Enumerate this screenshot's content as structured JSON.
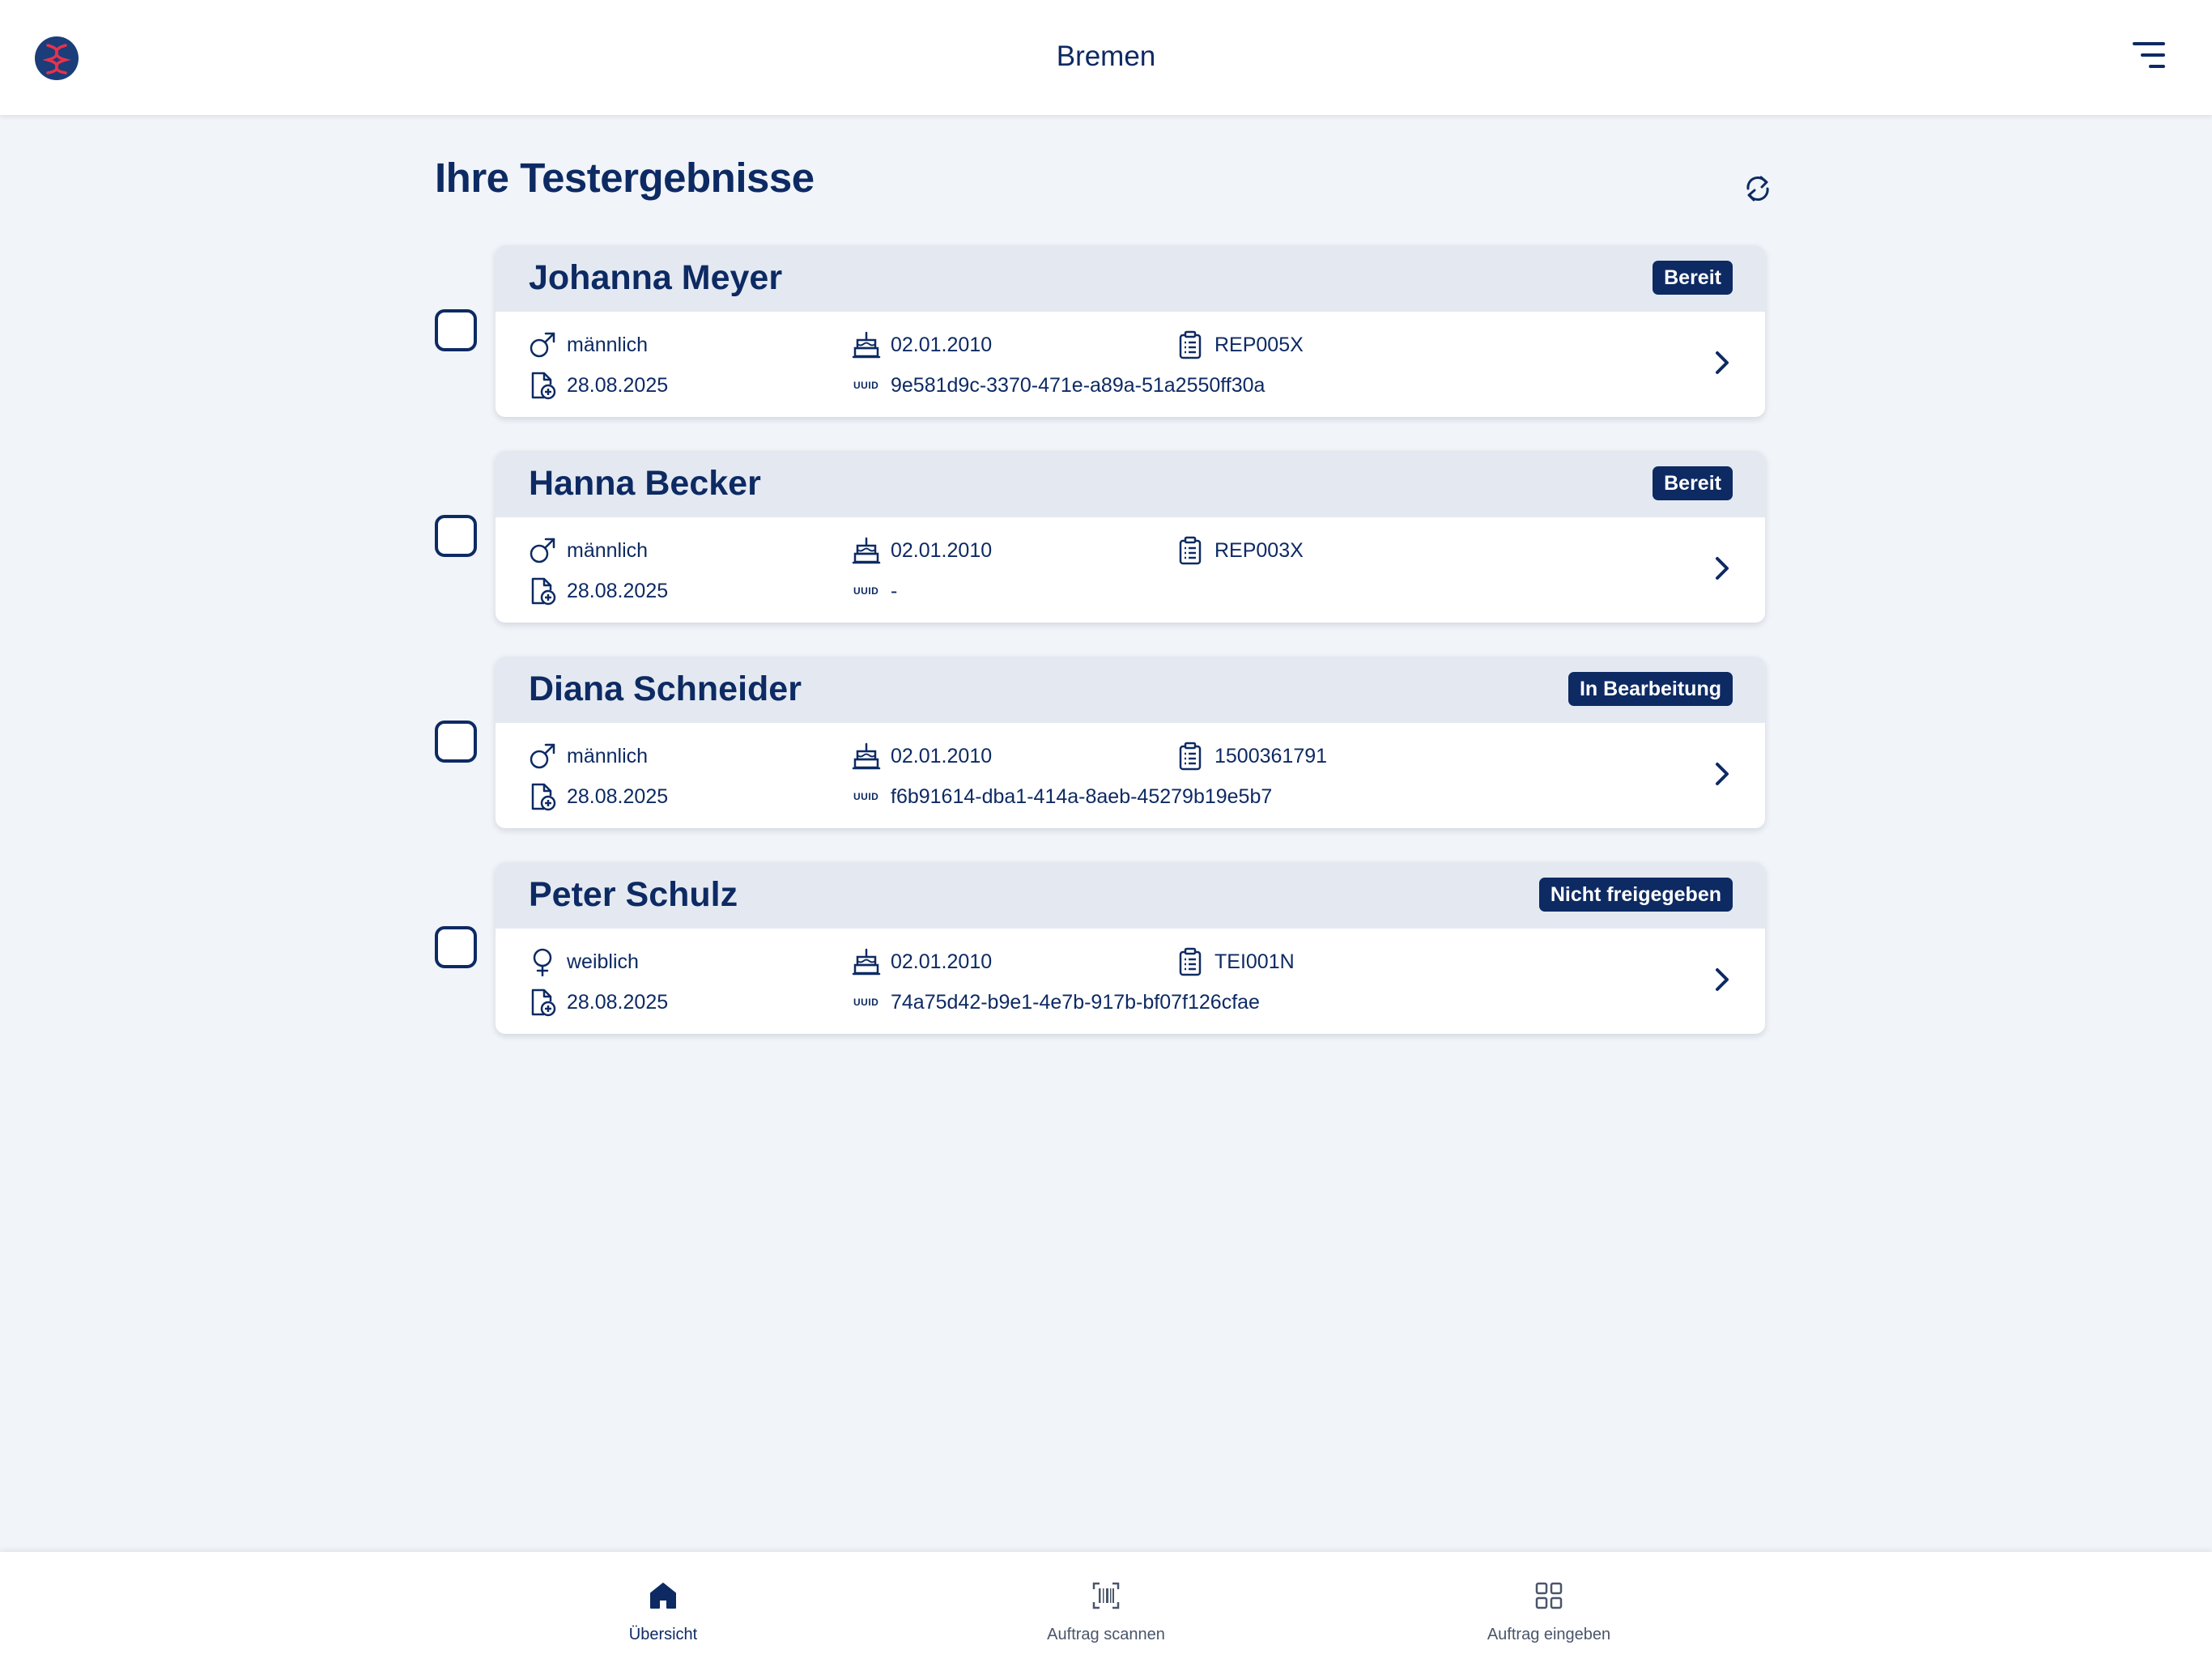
{
  "header": {
    "city": "Bremen"
  },
  "page": {
    "title": "Ihre Testergebnisse"
  },
  "results": [
    {
      "name": "Johanna Meyer",
      "status": "Bereit",
      "gender": "männlich",
      "gender_icon": "male-icon",
      "birthdate": "02.01.2010",
      "order_id": "REP005X",
      "created": "28.08.2025",
      "uuid_label": "UUID",
      "uuid": "9e581d9c-3370-471e-a89a-51a2550ff30a"
    },
    {
      "name": "Hanna Becker",
      "status": "Bereit",
      "gender": "männlich",
      "gender_icon": "male-icon",
      "birthdate": "02.01.2010",
      "order_id": "REP003X",
      "created": "28.08.2025",
      "uuid_label": "UUID",
      "uuid": "-"
    },
    {
      "name": "Diana Schneider",
      "status": "In Bearbeitung",
      "gender": "männlich",
      "gender_icon": "male-icon",
      "birthdate": "02.01.2010",
      "order_id": "1500361791",
      "created": "28.08.2025",
      "uuid_label": "UUID",
      "uuid": "f6b91614-dba1-414a-8aeb-45279b19e5b7"
    },
    {
      "name": "Peter Schulz",
      "status": "Nicht freigegeben",
      "gender": "weiblich",
      "gender_icon": "female-icon",
      "birthdate": "02.01.2010",
      "order_id": "TEI001N",
      "created": "28.08.2025",
      "uuid_label": "UUID",
      "uuid": "74a75d42-b9e1-4e7b-917b-bf07f126cfae"
    }
  ],
  "bottom_nav": [
    {
      "label": "Übersicht",
      "icon": "home-icon",
      "active": true
    },
    {
      "label": "Auftrag scannen",
      "icon": "scan-icon",
      "active": false
    },
    {
      "label": "Auftrag eingeben",
      "icon": "grid-icon",
      "active": false
    }
  ],
  "colors": {
    "primary": "#0d2a63",
    "accent_red": "#e5334b",
    "background": "#f1f4f8",
    "card_header": "#e4e9f1"
  }
}
